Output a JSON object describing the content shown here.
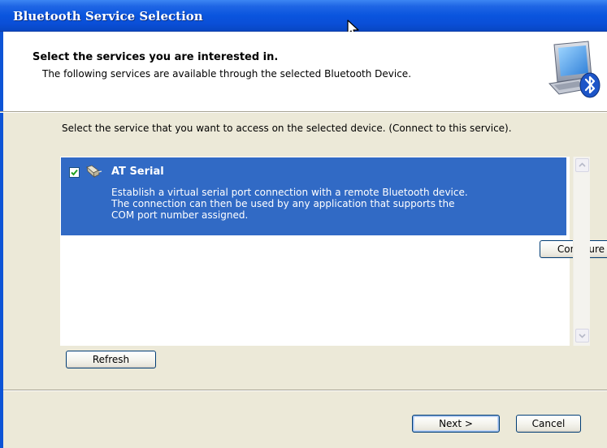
{
  "window": {
    "title": "Bluetooth Service Selection"
  },
  "header": {
    "heading": "Select the services you are interested in.",
    "subheading": "The following services are available through the selected Bluetooth Device.",
    "icon": "bluetooth-computer-icon"
  },
  "main": {
    "instructions": "Select the service that you want to access on the selected device. (Connect to this service).",
    "services": [
      {
        "name": "AT Serial",
        "checked": true,
        "icon": "serial-plug-icon",
        "description": "Establish a virtual serial port connection with a remote Bluetooth device. The connection can then be used by any application that supports the COM port number assigned.",
        "configure_label": "Configure"
      }
    ],
    "refresh_label": "Refresh"
  },
  "footer": {
    "next_label": "Next >",
    "cancel_label": "Cancel"
  },
  "colors": {
    "titlebar": "#0a55de",
    "selection": "#316ac5",
    "dialog_face": "#ece9d8"
  }
}
